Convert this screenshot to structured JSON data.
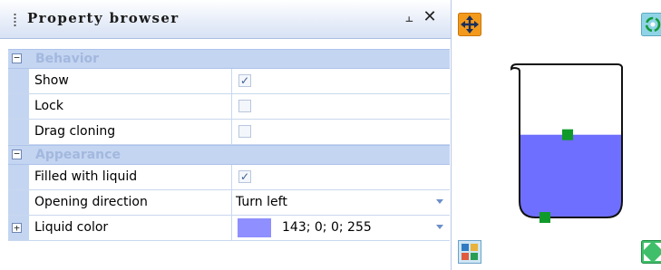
{
  "panel": {
    "title": "Property browser",
    "pin_glyph": "⫠",
    "close_glyph": "✕"
  },
  "categories": [
    {
      "label": "Behavior",
      "toggle": "−",
      "properties": [
        {
          "name": "Show",
          "type": "checkbox",
          "checked": true,
          "check_glyph": "✓"
        },
        {
          "name": "Lock",
          "type": "checkbox",
          "checked": false,
          "check_glyph": ""
        },
        {
          "name": "Drag cloning",
          "type": "checkbox",
          "checked": false,
          "check_glyph": ""
        }
      ]
    },
    {
      "label": "Appearance",
      "toggle": "−",
      "properties": [
        {
          "name": "Filled with liquid",
          "type": "checkbox",
          "checked": true,
          "check_glyph": "✓"
        },
        {
          "name": "Opening direction",
          "type": "dropdown",
          "value": "Turn left"
        },
        {
          "name": "Liquid color",
          "type": "color",
          "value": "143; 0; 0; 255",
          "swatch": "#8f8fff",
          "expand": "+"
        }
      ]
    }
  ],
  "canvas": {
    "tools": [
      "move-icon",
      "rotate-icon",
      "replace-image-icon",
      "resize-icon"
    ],
    "beaker": {
      "liquid_color": "#6f6fff",
      "fill_level": 0.55,
      "handle_color": "#109a2a"
    }
  },
  "colors": {
    "category_bg": "#c4d5f2",
    "category_text": "#a3b8de",
    "grid_line": "#c9d7ee"
  }
}
